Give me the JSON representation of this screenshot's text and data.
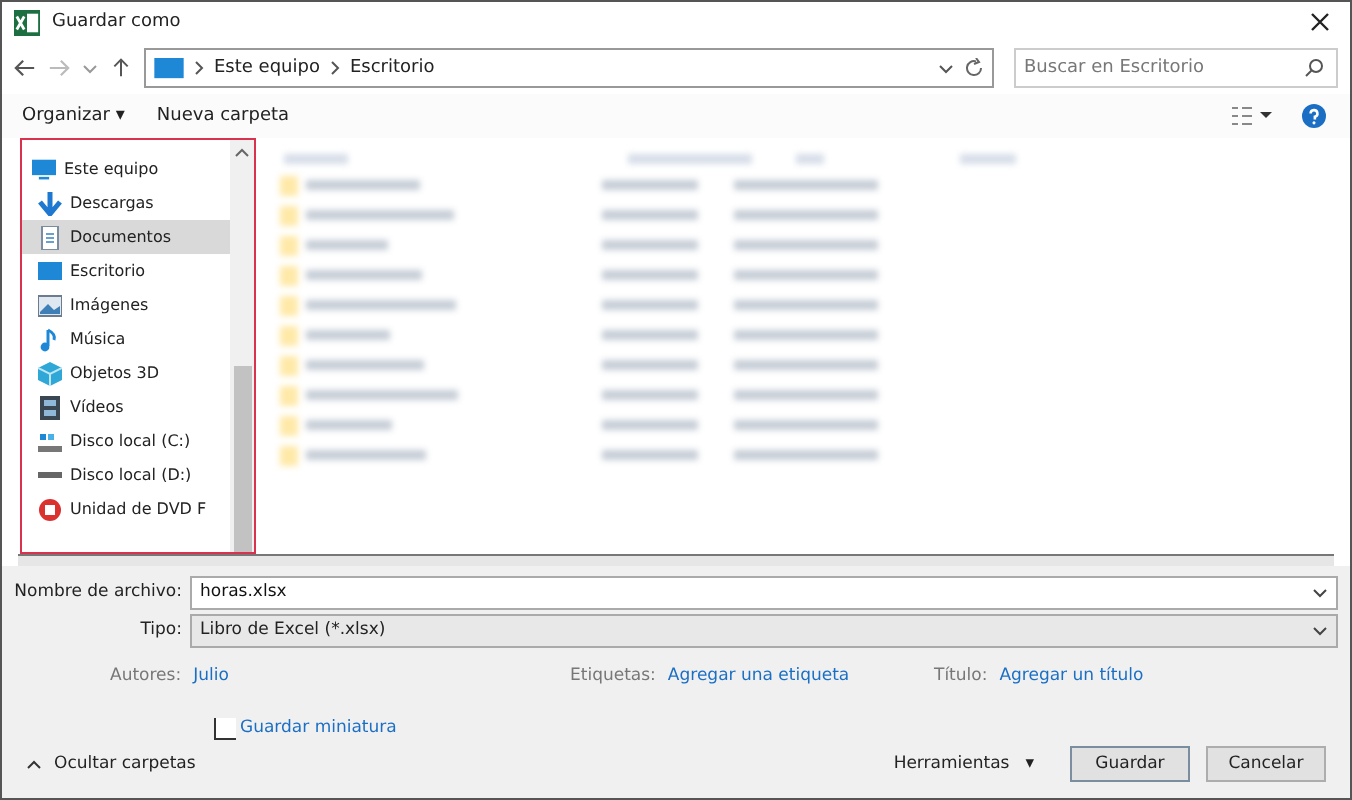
{
  "window": {
    "title": "Guardar como"
  },
  "address": {
    "crumbs": [
      "Este equipo",
      "Escritorio"
    ],
    "search_placeholder": "Buscar en Escritorio"
  },
  "toolbar": {
    "organize": "Organizar",
    "organize_caret": "▾",
    "new_folder": "Nueva carpeta"
  },
  "sidebar": {
    "items": [
      {
        "label": "Este equipo",
        "kind": "computer",
        "selected": false,
        "children": [
          {
            "label": "Descargas",
            "kind": "downloads",
            "selected": false
          },
          {
            "label": "Documentos",
            "kind": "documents",
            "selected": true
          },
          {
            "label": "Escritorio",
            "kind": "desktop",
            "selected": false
          },
          {
            "label": "Imágenes",
            "kind": "pictures",
            "selected": false
          },
          {
            "label": "Música",
            "kind": "music",
            "selected": false
          },
          {
            "label": "Objetos 3D",
            "kind": "objects3d",
            "selected": false
          },
          {
            "label": "Vídeos",
            "kind": "videos",
            "selected": false
          },
          {
            "label": "Disco local (C:)",
            "kind": "system-disk",
            "selected": false
          },
          {
            "label": "Disco local (D:)",
            "kind": "disk",
            "selected": false
          },
          {
            "label": "Unidad de DVD F",
            "kind": "dvd",
            "selected": false
          }
        ]
      }
    ]
  },
  "form": {
    "filename_label": "Nombre de archivo:",
    "filename": "horas.xlsx",
    "type_label": "Tipo:",
    "type": "Libro de Excel (*.xlsx)",
    "meta": [
      {
        "label": "Autores:",
        "value": "Julio"
      },
      {
        "label": "Etiquetas:",
        "value": "Agregar una etiqueta"
      },
      {
        "label": "Título:",
        "value": "Agregar un título"
      }
    ],
    "thumbnail": {
      "label": "Guardar miniatura",
      "checked": false
    }
  },
  "footer": {
    "hide_folders": "Ocultar carpetas",
    "tools": "Herramientas",
    "tools_caret": "▾",
    "save": "Guardar",
    "cancel": "Cancelar"
  }
}
